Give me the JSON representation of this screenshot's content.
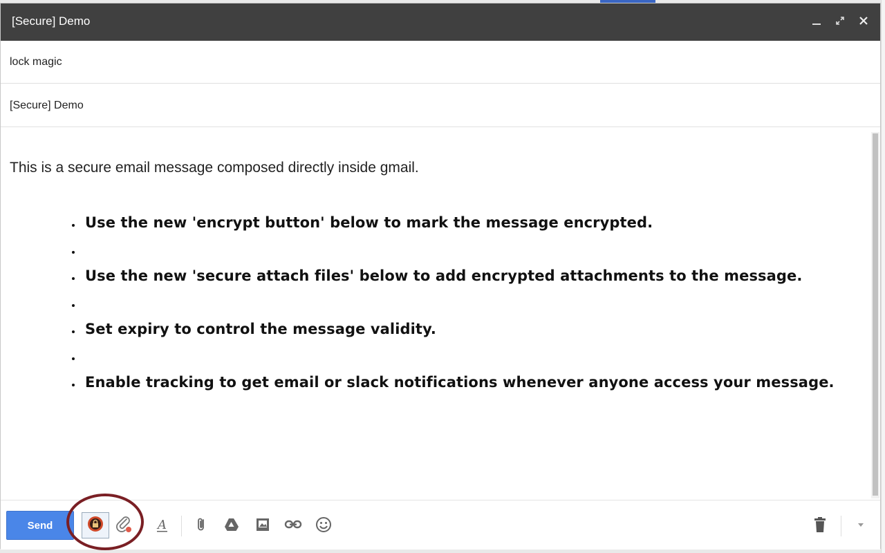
{
  "window": {
    "title": "[Secure] Demo",
    "controls": [
      "minimize-icon",
      "pop-out-icon",
      "close-icon"
    ]
  },
  "to": {
    "value": "lock magic"
  },
  "subject": {
    "value": "[Secure] Demo"
  },
  "body": {
    "intro": "This is a secure email message composed directly inside gmail.",
    "bullets": [
      "Use the new 'encrypt button' below to mark the message encrypted.",
      "",
      "Use the new 'secure attach files' below to add encrypted attachments to the message.",
      "",
      "Set expiry to control the message validity.",
      "",
      "Enable tracking to get email or slack notifications whenever anyone access your message."
    ]
  },
  "toolbar": {
    "send_label": "Send",
    "icons": [
      "encrypt-lock-icon",
      "secure-attach-icon",
      "formatting-icon",
      "attach-icon",
      "drive-icon",
      "photo-icon",
      "link-icon",
      "emoji-icon",
      "trash-icon",
      "more-options-icon"
    ]
  },
  "colors": {
    "titlebar": "#404040",
    "send": "#4a86e8",
    "highlight": "#7a1f24",
    "encrypt": "#d04a2a"
  }
}
